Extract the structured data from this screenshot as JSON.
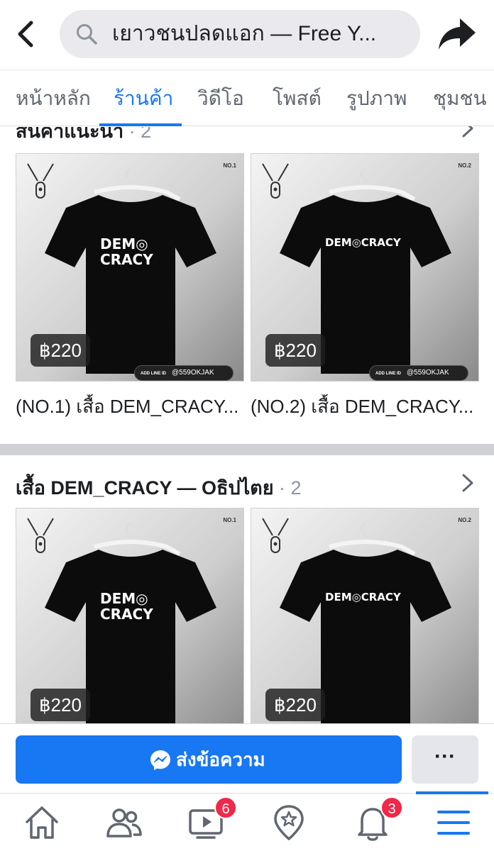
{
  "search": {
    "query": "เยาวชนปลดแอก — Free Y..."
  },
  "tabs": [
    {
      "label": "หน้าหลัก"
    },
    {
      "label": "ร้านค้า"
    },
    {
      "label": "วิดีโอ"
    },
    {
      "label": "โพสต์"
    },
    {
      "label": "รูปภาพ"
    },
    {
      "label": "ชุมชน"
    }
  ],
  "active_tab": "ร้านค้า",
  "sections": [
    {
      "title": "สินค้าแนะนำ",
      "count": "· 2",
      "products": [
        {
          "no_label": "NO.1",
          "shirt_line1": "DEM◎",
          "shirt_line2": "CRACY",
          "price": "฿220",
          "line_id": "@559OKJAK",
          "add_line": "ADD LINE ID",
          "title": "(NO.1) เสื้อ DEM_CRACY..."
        },
        {
          "no_label": "NO.2",
          "shirt_line1": "DEM◎CRACY",
          "price": "฿220",
          "line_id": "@559OKJAK",
          "add_line": "ADD LINE ID",
          "title": "(NO.2) เสื้อ DEM_CRACY..."
        }
      ]
    },
    {
      "title": "เสื้อ DEM_CRACY — Oธิปไตย",
      "count": "· 2",
      "products": [
        {
          "no_label": "NO.1",
          "shirt_line1": "DEM◎",
          "shirt_line2": "CRACY",
          "price": "฿220"
        },
        {
          "no_label": "NO.2",
          "shirt_line1": "DEM◎CRACY",
          "price": "฿220"
        }
      ]
    }
  ],
  "actions": {
    "message_label": "ส่งข้อความ",
    "more_label": "···"
  },
  "nav": {
    "video_badge": "6",
    "notifications_badge": "3"
  },
  "colors": {
    "accent": "#1877f2",
    "badge": "#f02849"
  }
}
